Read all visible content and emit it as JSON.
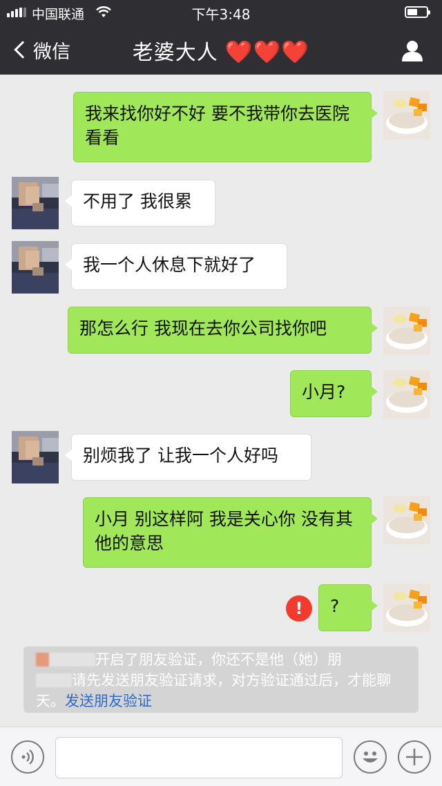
{
  "status_bar": {
    "carrier": "中国联通",
    "time": "下午3:48"
  },
  "nav": {
    "back_label": "微信",
    "title": "老婆大人",
    "title_suffix": "❤️❤️❤️"
  },
  "messages": [
    {
      "from": "me",
      "text": "我来找你好不好 要不我带你去医院看看"
    },
    {
      "from": "other",
      "text": "不用了 我很累"
    },
    {
      "from": "other",
      "text": "我一个人休息下就好了"
    },
    {
      "from": "me",
      "text": "那怎么行 我现在去你公司找你吧"
    },
    {
      "from": "me",
      "text": "小月?"
    },
    {
      "from": "other",
      "text": "别烦我了 让我一个人好吗"
    },
    {
      "from": "me",
      "text": "小月 别这样阿 我是关心你 没有其他的意思"
    },
    {
      "from": "me",
      "text": "?",
      "failed": true,
      "failed_icon": "!"
    }
  ],
  "system_notice": {
    "text_part1": "开启了朋友验证，你还不是他（她）朋",
    "text_part2": "请先发送朋友验证请求，对方验证通过后，才能聊天。",
    "link_text": "发送朋友验证"
  },
  "input": {
    "value": ""
  },
  "colors": {
    "nav_bg": "#2e2e33",
    "chat_bg": "#ebebeb",
    "bubble_me": "#a0e75a",
    "bubble_other": "#ffffff",
    "error": "#f23b2c",
    "link": "#2f6ac9"
  },
  "icons": [
    "signal-icon",
    "wifi-icon",
    "battery-icon",
    "back-chevron-icon",
    "profile-icon",
    "voice-icon",
    "emoji-icon",
    "plus-icon",
    "error-icon"
  ]
}
